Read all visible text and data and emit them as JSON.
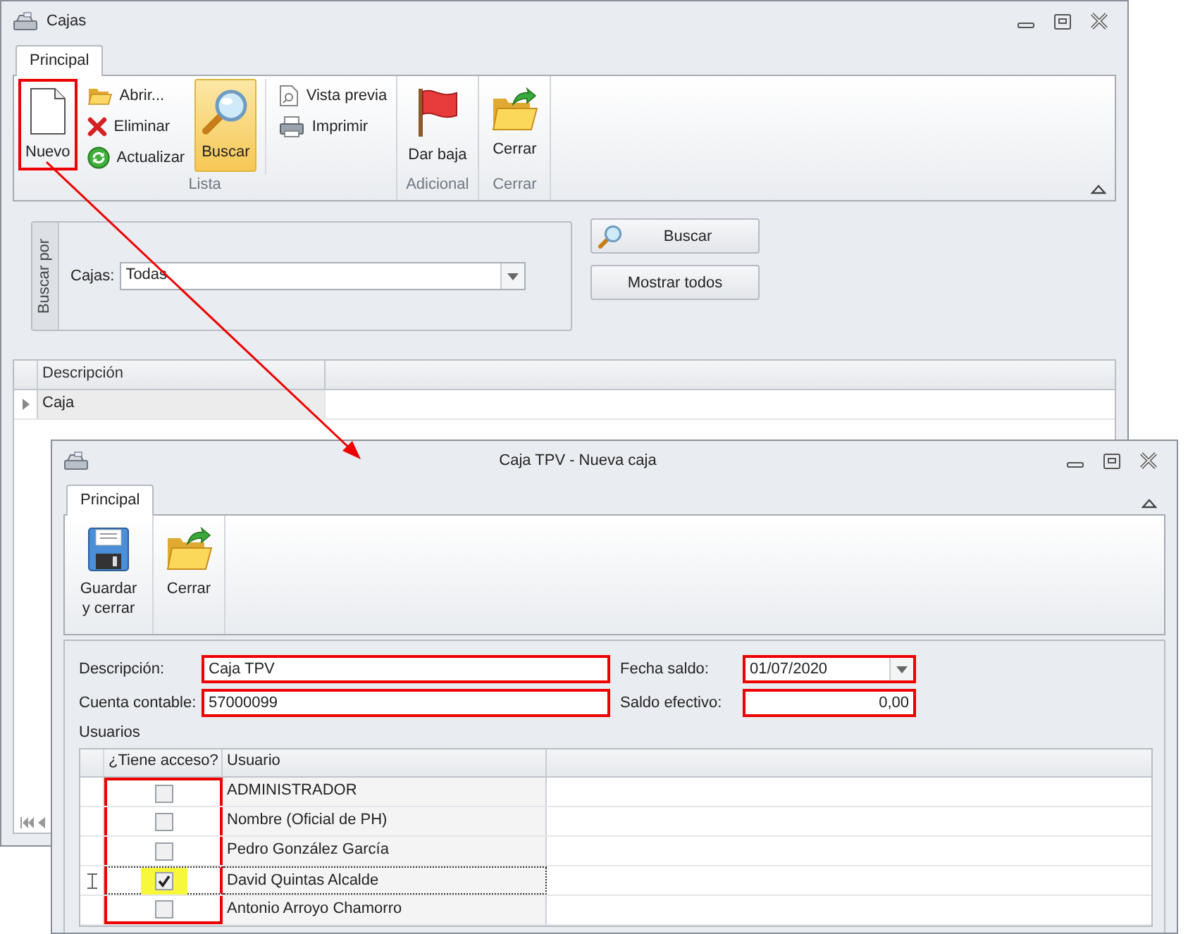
{
  "main_window": {
    "title": "Cajas",
    "tabs": [
      {
        "label": "Principal",
        "selected": true
      }
    ],
    "ribbon_groups": [
      {
        "label": "Lista",
        "items": [
          {
            "label": "Nuevo",
            "kind": "large",
            "pressed": false,
            "highlighted": true
          },
          {
            "label": "Abrir...",
            "kind": "small",
            "pressed": false,
            "highlighted": false
          },
          {
            "label": "Eliminar",
            "kind": "small",
            "pressed": false,
            "highlighted": false
          },
          {
            "label": "Actualizar",
            "kind": "small",
            "pressed": false,
            "highlighted": false
          },
          {
            "label": "Buscar",
            "kind": "large",
            "pressed": true,
            "highlighted": false
          },
          {
            "label": "Vista previa",
            "kind": "small",
            "pressed": false,
            "highlighted": false
          },
          {
            "label": "Imprimir",
            "kind": "small",
            "pressed": false,
            "highlighted": false
          }
        ]
      },
      {
        "label": "Adicional",
        "items": [
          {
            "label": "Dar baja",
            "kind": "large",
            "pressed": false,
            "highlighted": false
          }
        ]
      },
      {
        "label": "Cerrar",
        "items": [
          {
            "label": "Cerrar",
            "kind": "large",
            "pressed": false,
            "highlighted": false
          }
        ]
      }
    ],
    "search": {
      "group_label": "Buscar por",
      "field_label": "Cajas:",
      "value": "Todas",
      "buttons": [
        {
          "label": "Buscar",
          "kind": "icon"
        },
        {
          "label": "Mostrar todos",
          "kind": "plain"
        }
      ]
    },
    "grid": {
      "columns": [
        "Descripción"
      ],
      "rows": [
        {
          "cells": [
            "Caja"
          ],
          "selected": true
        }
      ]
    }
  },
  "dialog": {
    "title": "Caja TPV - Nueva caja",
    "tabs": [
      {
        "label": "Principal",
        "selected": true
      }
    ],
    "ribbon_groups": [
      {
        "items": [
          {
            "label": "Guardar y cerrar",
            "kind": "large",
            "pressed": false,
            "highlighted": false
          }
        ]
      },
      {
        "items": [
          {
            "label": "Cerrar",
            "kind": "large",
            "pressed": false,
            "highlighted": false
          }
        ]
      }
    ],
    "fields": [
      {
        "label": "Descripción:",
        "value": "Caja TPV",
        "kind": "text",
        "highlighted": true
      },
      {
        "label": "Fecha saldo:",
        "value": "01/07/2020",
        "kind": "date",
        "highlighted": true
      },
      {
        "label": "Cuenta contable:",
        "value": "57000099",
        "kind": "text",
        "highlighted": true
      },
      {
        "label": "Saldo efectivo:",
        "value": "0,00",
        "kind": "number",
        "highlighted": true
      }
    ],
    "users": {
      "label": "Usuarios",
      "columns": [
        {
          "label": "¿Tiene acceso?",
          "highlighted": true
        },
        {
          "label": "Usuario",
          "highlighted": false
        }
      ],
      "rows": [
        {
          "has_access": false,
          "user": "ADMINISTRADOR",
          "selected": false,
          "marked": false
        },
        {
          "has_access": false,
          "user": "Nombre (Oficial de PH)",
          "selected": false,
          "marked": false
        },
        {
          "has_access": false,
          "user": "Pedro González García",
          "selected": false,
          "marked": false
        },
        {
          "has_access": true,
          "user": "David Quintas Alcalde",
          "selected": true,
          "marked": true
        },
        {
          "has_access": false,
          "user": "Antonio Arroyo Chamorro",
          "selected": false,
          "marked": false
        }
      ]
    }
  }
}
